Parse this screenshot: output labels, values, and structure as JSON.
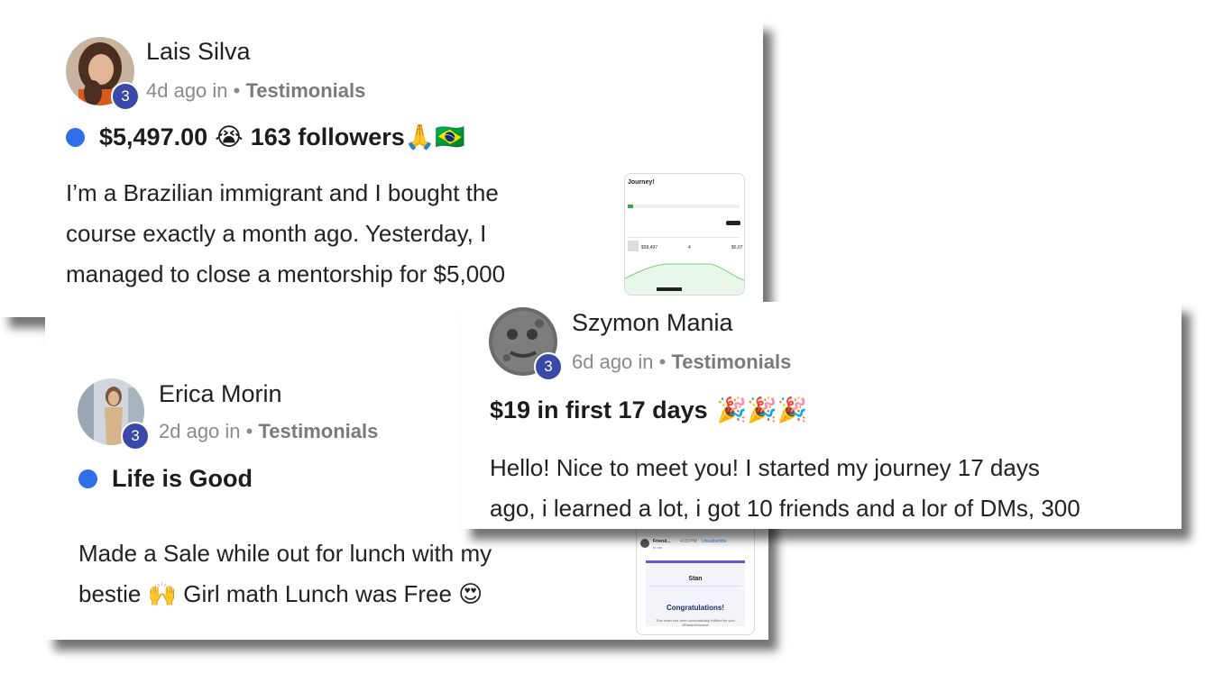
{
  "posts": [
    {
      "author": "Lais Silva",
      "level": "3",
      "time": "4d ago in",
      "category": "Testimonials",
      "title": "$5,497.00",
      "title_emoji_1": "😭",
      "title_rest": "163 followers",
      "title_emoji_2": "🙏🇧🇷",
      "body": "I’m a Brazilian immigrant and I bought the\ncourse exactly a month ago. Yesterday, I\nmanaged to close a mentorship for $5,000",
      "thumb_title": "Journey!",
      "thumb_values": [
        "$58,497",
        "4",
        "$5,07"
      ]
    },
    {
      "author": "Erica Morin",
      "level": "3",
      "time": "2d ago in",
      "category": "Testimonials",
      "title": "Life is Good",
      "body_1": "Made a Sale while out for lunch with my",
      "body_2": "bestie",
      "body_emoji_1": "🙌",
      "body_3": "Girl math Lunch was Free",
      "body_emoji_2": "😍",
      "thumb": {
        "sender": "Friend...",
        "time": "4:03 PM",
        "unsubscribe": "Unsubscribe",
        "to": "to me",
        "brand": "Stan",
        "heading": "Congratulations!",
        "note": "This order has been automatically fulfilled for you! #PassiveIncome"
      }
    },
    {
      "author": "Szymon Mania",
      "level": "3",
      "time": "6d ago in",
      "category": "Testimonials",
      "title": "$19 in first 17 days",
      "title_emoji": "🎉🎉🎉",
      "body": "Hello! Nice to meet you! I started my journey 17 days\nago, i learned a lot, i got 10 friends and a lor of DMs, 300"
    }
  ]
}
